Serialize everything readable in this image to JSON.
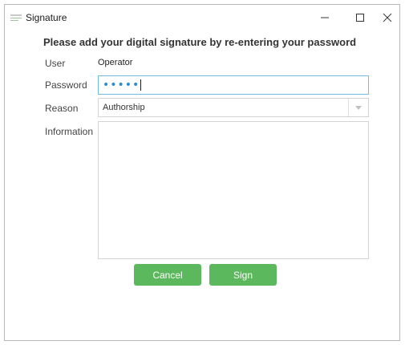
{
  "window": {
    "title": "Signature",
    "minimize_icon": "minimize-icon",
    "maximize_icon": "maximize-icon",
    "close_icon": "close-icon"
  },
  "form": {
    "heading": "Please add your digital signature by re-entering your password",
    "user_label": "User",
    "user_value": "Operator",
    "password_label": "Password",
    "password_mask": "•••••",
    "reason_label": "Reason",
    "reason_value": "Authorship",
    "information_label": "Information",
    "information_value": ""
  },
  "buttons": {
    "cancel_label": "Cancel",
    "sign_label": "Sign"
  },
  "colors": {
    "button_green": "#5cb85c",
    "focus_border": "#6fbde3",
    "password_dots": "#2a8dd4"
  }
}
